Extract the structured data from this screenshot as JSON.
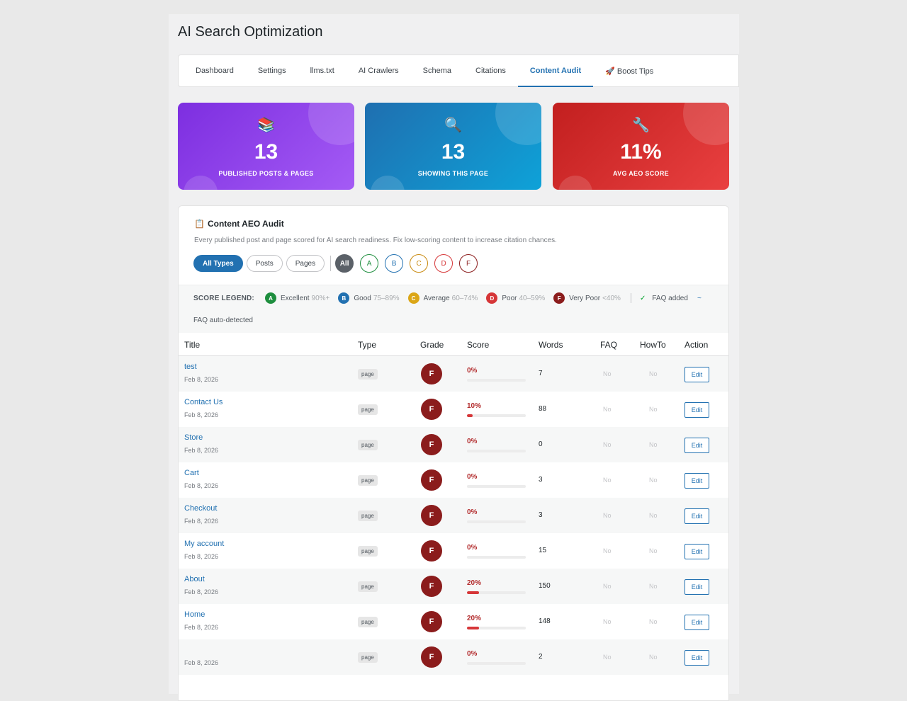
{
  "page": {
    "title": "AI Search Optimization"
  },
  "tabs": [
    {
      "label": "Dashboard",
      "active": false
    },
    {
      "label": "Settings",
      "active": false
    },
    {
      "label": "llms.txt",
      "active": false
    },
    {
      "label": "AI Crawlers",
      "active": false
    },
    {
      "label": "Schema",
      "active": false
    },
    {
      "label": "Citations",
      "active": false
    },
    {
      "label": "Content Audit",
      "active": true
    },
    {
      "label": "🚀 Boost Tips",
      "active": false
    }
  ],
  "stats": [
    {
      "icon": "📚",
      "value": "13",
      "label": "PUBLISHED POSTS & PAGES"
    },
    {
      "icon": "🔍",
      "value": "13",
      "label": "SHOWING THIS PAGE"
    },
    {
      "icon": "🔧",
      "value": "11%",
      "label": "AVG AEO SCORE"
    }
  ],
  "audit": {
    "icon": "📋",
    "title": "Content AEO Audit",
    "description": "Every published post and page scored for AI search readiness. Fix low-scoring content to increase citation chances.",
    "type_filters": [
      {
        "label": "All Types",
        "active": true
      },
      {
        "label": "Posts",
        "active": false
      },
      {
        "label": "Pages",
        "active": false
      }
    ],
    "grade_filters": [
      {
        "label": "All",
        "color": "#5b6168",
        "active": true
      },
      {
        "label": "A",
        "color": "#00a32a",
        "active": false
      },
      {
        "label": "B",
        "color": "#2271b1",
        "active": false
      },
      {
        "label": "C",
        "color": "#dba617",
        "active": false
      },
      {
        "label": "D",
        "color": "#d63638",
        "active": false
      },
      {
        "label": "F",
        "color": "#8b1c1c",
        "active": false
      }
    ]
  },
  "legend": {
    "title": "SCORE LEGEND:",
    "items": [
      {
        "grade": "A",
        "label": "Excellent",
        "range": "90%+",
        "color": "#1e8e3e"
      },
      {
        "grade": "B",
        "label": "Good",
        "range": "75–89%",
        "color": "#2271b1"
      },
      {
        "grade": "C",
        "label": "Average",
        "range": "60–74%",
        "color": "#dba617"
      },
      {
        "grade": "D",
        "label": "Poor",
        "range": "40–59%",
        "color": "#d63638"
      },
      {
        "grade": "F",
        "label": "Very Poor",
        "range": "<40%",
        "color": "#8b1c1c"
      }
    ],
    "faq_added_symbol": "✓",
    "faq_added": "FAQ added",
    "faq_auto_symbol": "~",
    "faq_auto": "FAQ auto-detected"
  },
  "table": {
    "headers": [
      "Title",
      "Type",
      "Grade",
      "Score",
      "Words",
      "FAQ",
      "HowTo",
      "Action"
    ],
    "rows": [
      {
        "title": "test",
        "date": "Feb 8, 2026",
        "type": "page",
        "grade": "F",
        "score": 0,
        "score_label": "0%",
        "words": "7",
        "faq": "No",
        "howto": "No",
        "action": "Edit"
      },
      {
        "title": "Contact Us",
        "date": "Feb 8, 2026",
        "type": "page",
        "grade": "F",
        "score": 10,
        "score_label": "10%",
        "words": "88",
        "faq": "No",
        "howto": "No",
        "action": "Edit"
      },
      {
        "title": "Store",
        "date": "Feb 8, 2026",
        "type": "page",
        "grade": "F",
        "score": 0,
        "score_label": "0%",
        "words": "0",
        "faq": "No",
        "howto": "No",
        "action": "Edit"
      },
      {
        "title": "Cart",
        "date": "Feb 8, 2026",
        "type": "page",
        "grade": "F",
        "score": 0,
        "score_label": "0%",
        "words": "3",
        "faq": "No",
        "howto": "No",
        "action": "Edit"
      },
      {
        "title": "Checkout",
        "date": "Feb 8, 2026",
        "type": "page",
        "grade": "F",
        "score": 0,
        "score_label": "0%",
        "words": "3",
        "faq": "No",
        "howto": "No",
        "action": "Edit"
      },
      {
        "title": "My account",
        "date": "Feb 8, 2026",
        "type": "page",
        "grade": "F",
        "score": 0,
        "score_label": "0%",
        "words": "15",
        "faq": "No",
        "howto": "No",
        "action": "Edit"
      },
      {
        "title": "About",
        "date": "Feb 8, 2026",
        "type": "page",
        "grade": "F",
        "score": 20,
        "score_label": "20%",
        "words": "150",
        "faq": "No",
        "howto": "No",
        "action": "Edit"
      },
      {
        "title": "Home",
        "date": "Feb 8, 2026",
        "type": "page",
        "grade": "F",
        "score": 20,
        "score_label": "20%",
        "words": "148",
        "faq": "No",
        "howto": "No",
        "action": "Edit"
      },
      {
        "title": "",
        "date": "Feb 8, 2026",
        "type": "page",
        "grade": "F",
        "score": 0,
        "score_label": "0%",
        "words": "2",
        "faq": "No",
        "howto": "No",
        "action": "Edit"
      }
    ]
  }
}
